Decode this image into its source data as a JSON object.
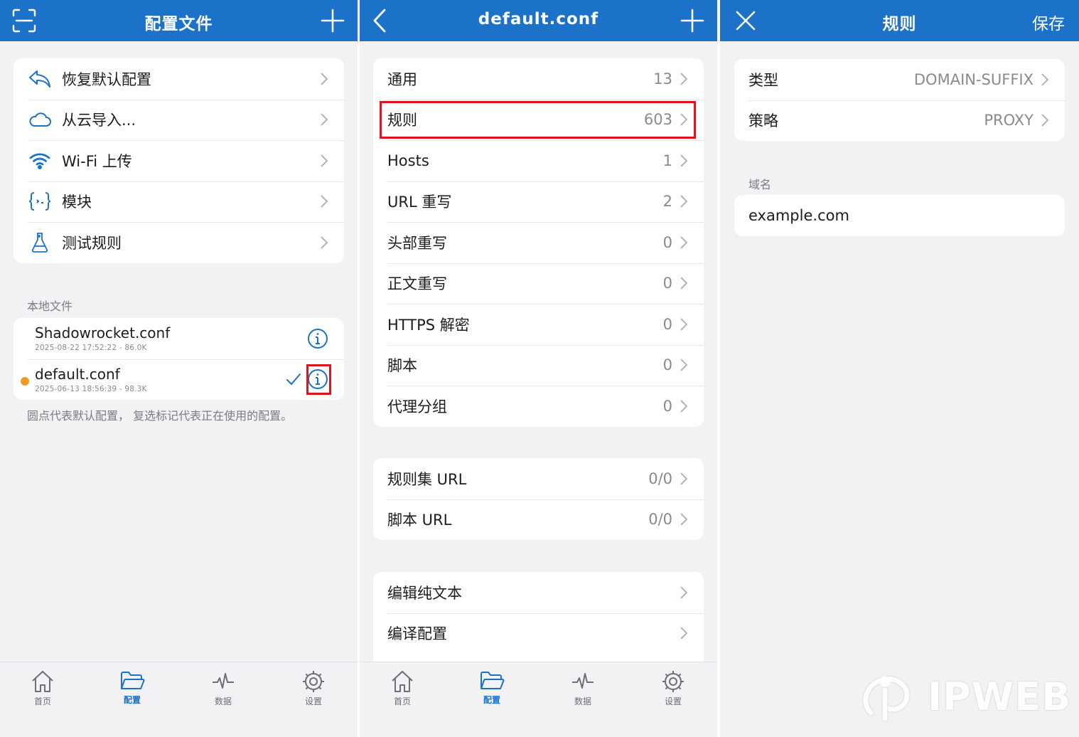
{
  "colors": {
    "nav": "#1c72c8",
    "accent": "#1c72c8",
    "highlight": "#e0141c",
    "dot": "#f29a25"
  },
  "panel1": {
    "title": "配置文件",
    "menu": [
      {
        "label": "恢复默认配置",
        "icon": "undo-icon"
      },
      {
        "label": "从云导入...",
        "icon": "cloud-icon"
      },
      {
        "label": "Wi-Fi 上传",
        "icon": "wifi-icon"
      },
      {
        "label": "模块",
        "icon": "module-braces-icon"
      },
      {
        "label": "测试规则",
        "icon": "flask-icon"
      }
    ],
    "local_header": "本地文件",
    "files": [
      {
        "name": "Shadowrocket.conf",
        "meta": "2025-08-22 17:52:22 - 86.0K"
      },
      {
        "name": "default.conf",
        "meta": "2025-06-13 18:56:39 - 98.3K"
      }
    ],
    "footnote": "圆点代表默认配置， 复选标记代表正在使用的配置。"
  },
  "panel2": {
    "title": "default.conf",
    "group1": [
      {
        "label": "通用",
        "value": "13"
      },
      {
        "label": "规则",
        "value": "603"
      },
      {
        "label": "Hosts",
        "value": "1"
      },
      {
        "label": "URL 重写",
        "value": "2"
      },
      {
        "label": "头部重写",
        "value": "0"
      },
      {
        "label": "正文重写",
        "value": "0"
      },
      {
        "label": "HTTPS 解密",
        "value": "0"
      },
      {
        "label": "脚本",
        "value": "0"
      },
      {
        "label": "代理分组",
        "value": "0"
      }
    ],
    "group2": [
      {
        "label": "规则集 URL",
        "value": "0/0"
      },
      {
        "label": "脚本 URL",
        "value": "0/0"
      }
    ],
    "group3": [
      {
        "label": "编辑纯文本"
      },
      {
        "label": "编译配置"
      }
    ]
  },
  "panel3": {
    "title": "规则",
    "save": "保存",
    "rows": [
      {
        "label": "类型",
        "value": "DOMAIN-SUFFIX"
      },
      {
        "label": "策略",
        "value": "PROXY"
      }
    ],
    "domain_header": "域名",
    "domain_value": "example.com"
  },
  "tabs": [
    {
      "label": "首页",
      "icon": "home-icon"
    },
    {
      "label": "配置",
      "icon": "folder-icon"
    },
    {
      "label": "数据",
      "icon": "activity-icon"
    },
    {
      "label": "设置",
      "icon": "gear-icon"
    }
  ],
  "watermark": "IPWEB"
}
